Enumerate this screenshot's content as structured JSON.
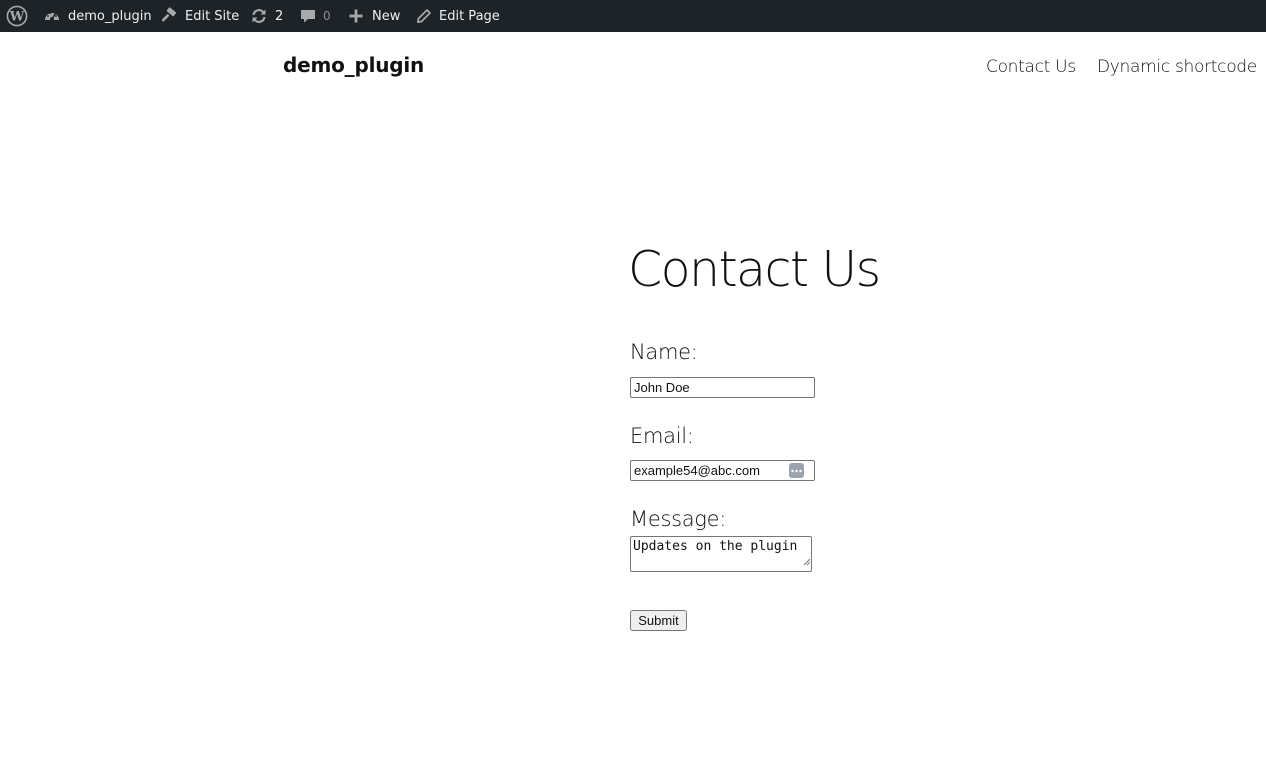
{
  "admin_bar": {
    "site_name": "demo_plugin",
    "edit_site": "Edit Site",
    "updates_count": "2",
    "comments_count": "0",
    "new_label": "New",
    "edit_page": "Edit Page",
    "icons": {
      "wordpress": "wordpress-logo-icon",
      "site": "dashboard-icon",
      "edit_site": "hammer-icon",
      "updates": "refresh-icon",
      "comments": "comment-bubble-icon",
      "new": "plus-icon",
      "edit_page": "pencil-icon"
    },
    "colors": {
      "background": "#1d2327",
      "text": "#f0f0f1",
      "muted": "#8c8f94"
    }
  },
  "header": {
    "site_title": "demo_plugin",
    "nav": [
      "Contact Us",
      "Dynamic shortcode"
    ]
  },
  "main": {
    "title": "Contact Us",
    "form": {
      "name_label": "Name:",
      "name_value": "John Doe",
      "email_label": "Email:",
      "email_value": "example54@abc.com",
      "message_label": "Message:",
      "message_value": "Updates on the plugin",
      "submit_label": "Submit"
    }
  }
}
